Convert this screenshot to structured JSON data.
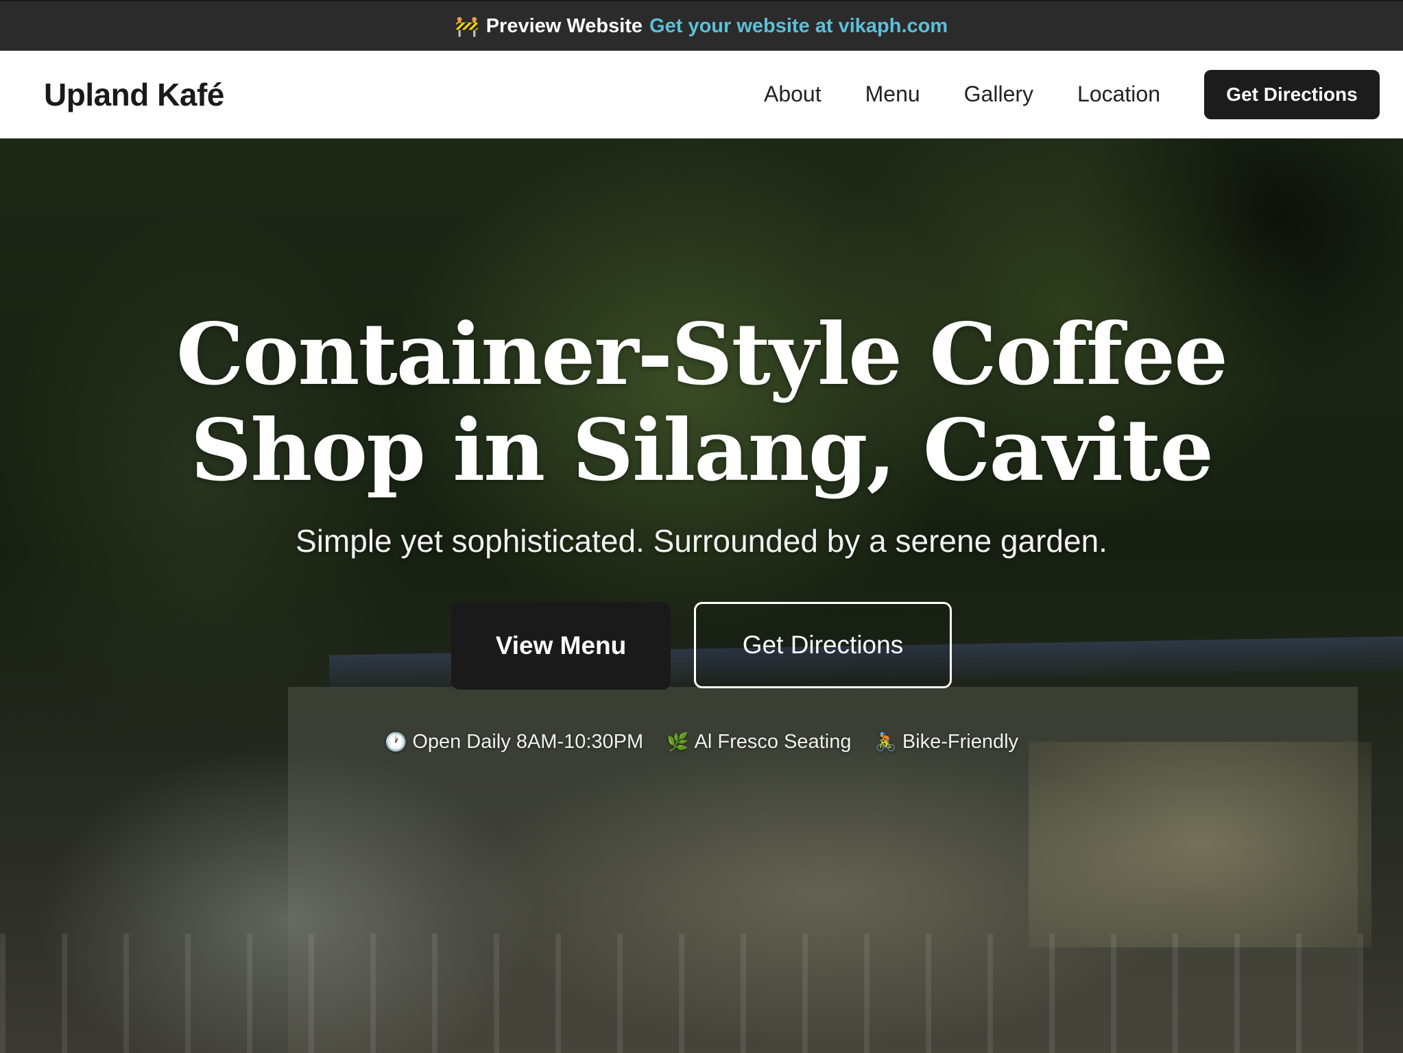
{
  "banner": {
    "icon": "🚧",
    "text": "Preview Website",
    "link_text": "Get your website at vikaph.com"
  },
  "header": {
    "brand": "Upland Kafé",
    "nav": [
      "About",
      "Menu",
      "Gallery",
      "Location"
    ],
    "cta_label": "Get Directions"
  },
  "hero": {
    "title": "Container-Style Coffee Shop in Silang, Cavite",
    "subtitle": "Simple yet sophisticated. Surrounded by a serene garden.",
    "primary_button": "View Menu",
    "secondary_button": "Get Directions",
    "features": [
      {
        "icon": "🕐",
        "text": "Open Daily 8AM-10:30PM"
      },
      {
        "icon": "🌿",
        "text": "Al Fresco Seating"
      },
      {
        "icon": "🚴",
        "text": "Bike-Friendly"
      }
    ]
  },
  "colors": {
    "banner_bg": "#2b2b2b",
    "banner_link": "#5bc0d8",
    "button_dark": "#1c1c1c",
    "header_bg": "#ffffff"
  }
}
